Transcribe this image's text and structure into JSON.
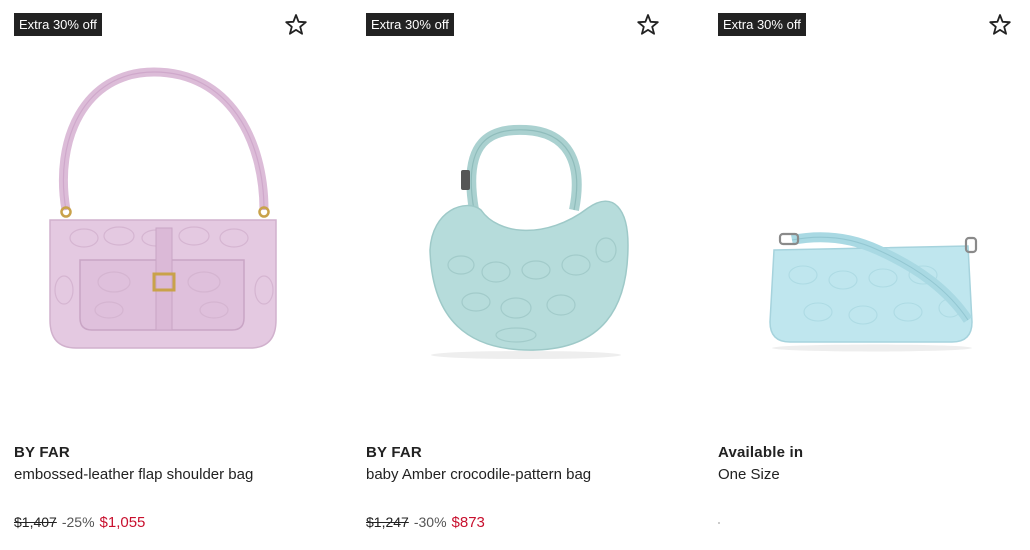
{
  "products": [
    {
      "badge": "Extra 30% off",
      "brand": "BY FAR",
      "description": "embossed-leather flap shoulder bag",
      "price_original": "$1,407",
      "discount": "-25%",
      "price_sale": "$1,055",
      "image_icon": "lilac-shoulder-bag",
      "bag_color": "#e4c9e1"
    },
    {
      "badge": "Extra 30% off",
      "brand": "BY FAR",
      "description": "baby Amber crocodile-pattern bag",
      "price_original": "$1,247",
      "discount": "-30%",
      "price_sale": "$873",
      "image_icon": "mint-hobo-bag",
      "bag_color": "#b6dcdb"
    },
    {
      "badge": "Extra 30% off",
      "brand": "Available in",
      "description": "One Size",
      "image_icon": "light-blue-crossbody-bag",
      "bag_color": "#bfe6ee"
    }
  ],
  "wishlist_icon": "star-outline-icon",
  "colors": {
    "badge_bg": "#222222",
    "badge_text": "#ffffff",
    "sale_price": "#c8102e"
  }
}
